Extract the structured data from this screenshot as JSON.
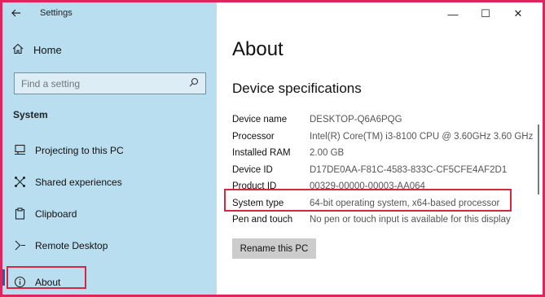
{
  "window": {
    "title": "Settings",
    "back_icon": "back-arrow-icon",
    "controls": {
      "minimize": "—",
      "maximize": "☐",
      "close": "✕"
    }
  },
  "sidebar": {
    "home_label": "Home",
    "search_placeholder": "Find a setting",
    "section_label": "System",
    "items": [
      {
        "label": "Projecting to this PC",
        "icon": "projector-icon"
      },
      {
        "label": "Shared experiences",
        "icon": "share-icon"
      },
      {
        "label": "Clipboard",
        "icon": "clipboard-icon"
      },
      {
        "label": "Remote Desktop",
        "icon": "remote-desktop-icon"
      },
      {
        "label": "About",
        "icon": "info-icon",
        "active": true
      }
    ]
  },
  "main": {
    "title": "About",
    "subheading": "Device specifications",
    "specs": [
      {
        "label": "Device name",
        "value": "DESKTOP-Q6A6PQG"
      },
      {
        "label": "Processor",
        "value": "Intel(R) Core(TM) i3-8100 CPU @ 3.60GHz   3.60 GHz"
      },
      {
        "label": "Installed RAM",
        "value": "2.00 GB"
      },
      {
        "label": "Device ID",
        "value": "D17DE0AA-F81C-4583-833C-CF5CFE4AF2D1"
      },
      {
        "label": "Product ID",
        "value": "00329-00000-00003-AA064"
      },
      {
        "label": "System type",
        "value": "64-bit operating system, x64-based processor"
      },
      {
        "label": "Pen and touch",
        "value": "No pen or touch input is available for this display"
      }
    ],
    "rename_button": "Rename this PC"
  },
  "colors": {
    "sidebar_bg": "#b9def0",
    "highlight": "#d7263d",
    "frame": "#e0245e",
    "button_bg": "#cccccc"
  }
}
